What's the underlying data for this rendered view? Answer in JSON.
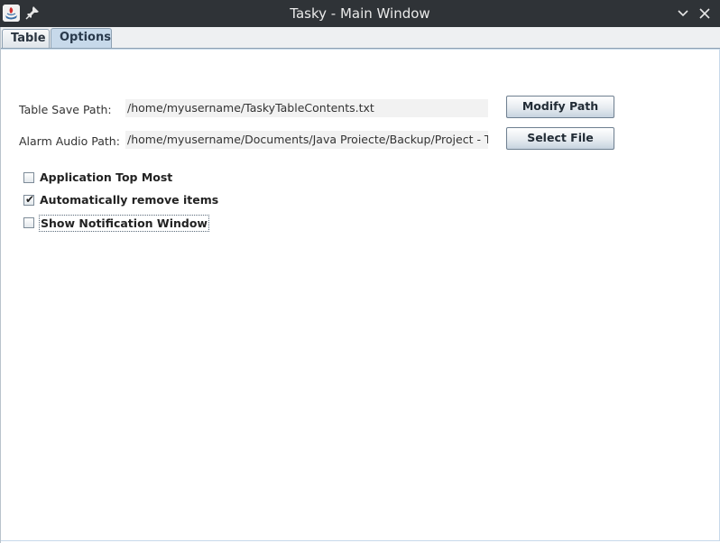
{
  "window": {
    "title": "Tasky - Main Window"
  },
  "tabs": [
    {
      "label": "Table",
      "selected": false
    },
    {
      "label": "Options",
      "selected": true
    }
  ],
  "options": {
    "save_path_label": "Table Save Path:",
    "save_path_value": "/home/myusername/TaskyTableContents.txt",
    "modify_path_button": "Modify Path",
    "alarm_path_label": "Alarm Audio Path:",
    "alarm_path_value": "/home/myusername/Documents/Java Proiecte/Backup/Project - Tasky/ja",
    "select_file_button": "Select File",
    "checkboxes": [
      {
        "label": "Application Top Most",
        "checked": false
      },
      {
        "label": "Automatically remove items",
        "checked": true
      },
      {
        "label": "Show Notification Window",
        "checked": false,
        "focused": true
      }
    ]
  },
  "colors": {
    "titlebar": "#2f3337",
    "selected_tab": "#c7d9ea",
    "field_background": "#f2f2f2"
  },
  "icons": [
    "app-icon",
    "pin-icon",
    "chevron-down-icon",
    "close-icon",
    "checkmark-icon"
  ]
}
